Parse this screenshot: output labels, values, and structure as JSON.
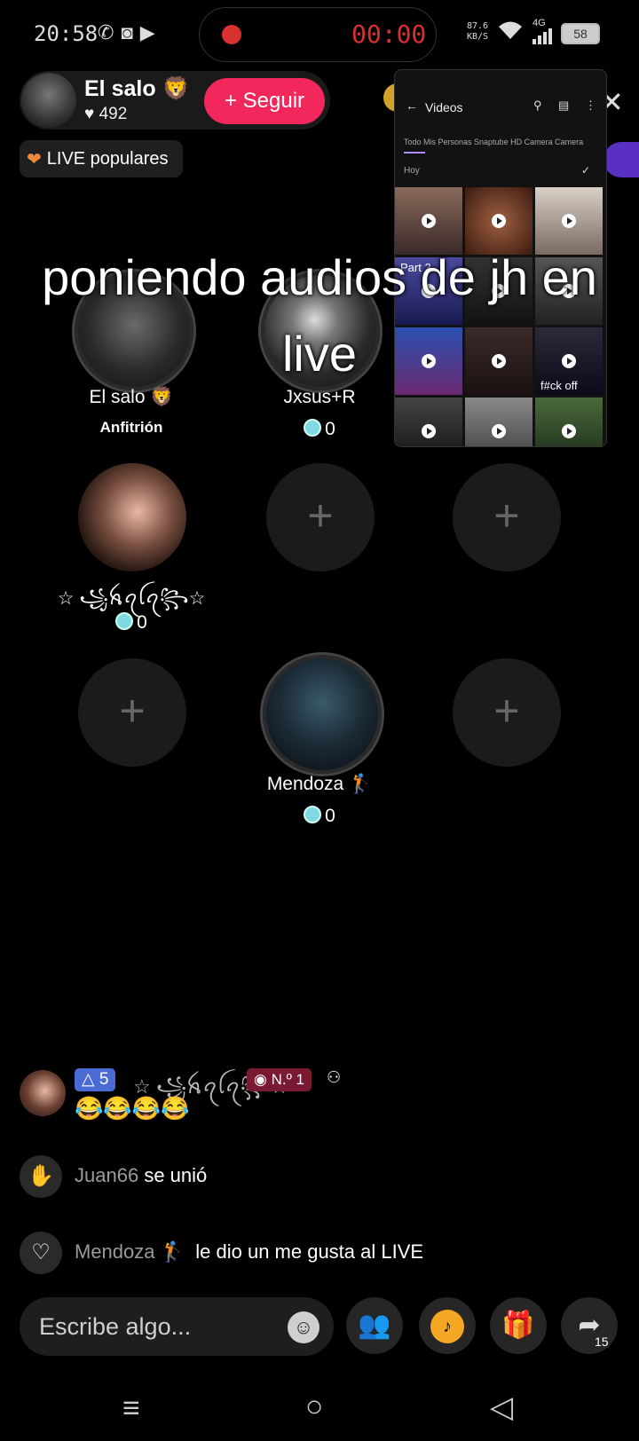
{
  "status_bar": {
    "time": "20:58",
    "notification_icons": [
      "whatsapp-icon",
      "discord-icon",
      "video-camera-icon"
    ],
    "recording_time": "00:00",
    "speed": [
      "87.6",
      "KB/S"
    ],
    "network": "4G",
    "battery": "58"
  },
  "host": {
    "name": "El salo 🦁",
    "likes": "492",
    "follow_label": "Seguir",
    "popular_label": "LIVE populares"
  },
  "caption": "poniendo audios de jh en live",
  "mini_window": {
    "title": "Videos",
    "tabs": "Todo   Mis Personas   Snaptube   HD Camera   Camera",
    "section": "Hoy",
    "thumb_labels": [
      "Part 2",
      "f#ck off"
    ]
  },
  "guests": [
    {
      "name": "El salo 🦁",
      "subtitle": "Anfitrión"
    },
    {
      "name": "Jxsus+R",
      "coins": "0"
    },
    {
      "name": "☆ ꧁ꫝꪖꪶꪖ꧂☆",
      "coins": "0"
    },
    {
      "name": "Mendoza 🏌",
      "coins": "0"
    }
  ],
  "chat": {
    "msg1": {
      "level": "5",
      "user": "☆ ꧁ꫝꪖꪶꪖ꧂☆",
      "rank": "N.º 1",
      "text": "😂😂😂😂"
    },
    "msg2": {
      "user": "Juan66",
      "text": "se unió"
    },
    "msg3": {
      "user": "Mendoza 🏌",
      "text": "le dio un me gusta al LIVE"
    }
  },
  "bottom": {
    "input_placeholder": "Escribe algo...",
    "share_count": "15"
  },
  "colors": {
    "accent": "#f2275b",
    "recording": "#d93030",
    "coin": "#7fd8e4"
  }
}
